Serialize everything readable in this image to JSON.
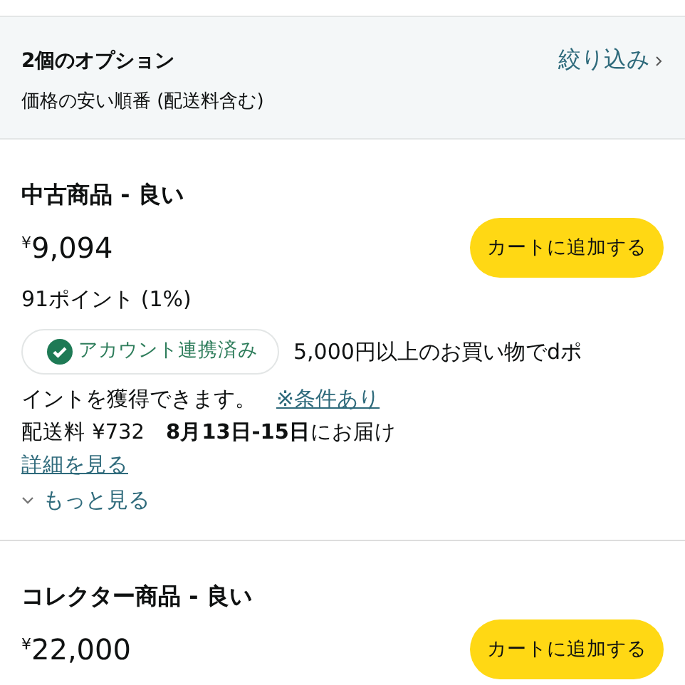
{
  "options_header": {
    "title": "2個のオプション",
    "sort": "価格の安い順番 (配送料含む)",
    "filter_link": "絞り込み"
  },
  "offers": [
    {
      "condition": "中古商品 - 良い",
      "price": "$^{¥}$9,094",
      "cart_button": "カートに追加する",
      "points": "91ポイント (1%)",
      "account_badge": "アカウント連携済み",
      "promo_text": "5,000円以上のお買い物でdポ",
      "promo_text_continued": "イントを獲得できます。",
      "promo_link": "※条件あり",
      "delivery": "配送料 ¥732　**8月13日-15日**にお届け",
      "details_link": "詳細を見る",
      "more_link": "もっと見る",
      "expanded": false
    },
    {
      "condition": "コレクター商品 - 良い",
      "price": "$^{¥}$22,000",
      "cart_button": "カートに追加する"
    }
  ]
}
